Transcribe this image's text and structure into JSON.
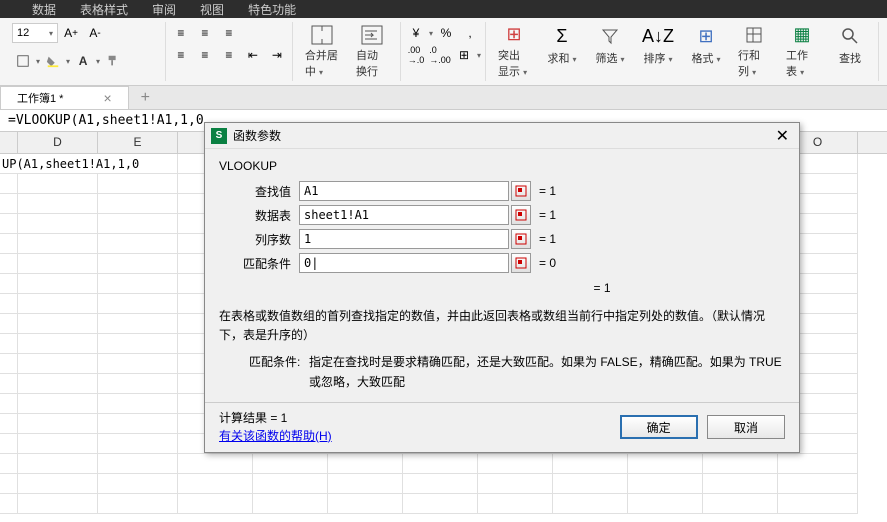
{
  "menubar": [
    "数据",
    "表格样式",
    "审阅",
    "视图",
    "特色功能"
  ],
  "ribbon": {
    "font_size": "12",
    "merge_label": "合并居中",
    "wrap_label": "自动换行",
    "highlight_label": "突出显示",
    "sum_label": "求和",
    "filter_label": "筛选",
    "sort_label": "排序",
    "format_label": "格式",
    "rowcol_label": "行和列",
    "sheet_label": "工作表",
    "find_label": "查找"
  },
  "tabs": {
    "active": "工作簿1 *"
  },
  "formula_bar": "=VLOOKUP(A1,sheet1!A1,1,0",
  "columns": [
    "D",
    "E",
    "",
    "",
    "",
    "",
    "",
    "",
    "",
    "O"
  ],
  "cell_a1": "UP(A1,sheet1!A1,1,0",
  "dialog": {
    "title": "函数参数",
    "func": "VLOOKUP",
    "params": [
      {
        "label": "查找值",
        "value": "A1",
        "result": "= 1"
      },
      {
        "label": "数据表",
        "value": "sheet1!A1",
        "result": "= 1"
      },
      {
        "label": "列序数",
        "value": "1",
        "result": "= 1"
      },
      {
        "label": "匹配条件",
        "value": "0|",
        "result": "= 0"
      }
    ],
    "overall_result": "= 1",
    "description": "在表格或数值数组的首列查找指定的数值，并由此返回表格或数组当前行中指定列处的数值。（默认情况下，表是升序的）",
    "param_desc_label": "匹配条件:",
    "param_desc_text": "指定在查找时是要求精确匹配，还是大致匹配。如果为 FALSE，精确匹配。如果为 TRUE 或忽略，大致匹配",
    "calc_result": "计算结果 = 1",
    "help_link": "有关该函数的帮助(H)",
    "ok": "确定",
    "cancel": "取消"
  }
}
